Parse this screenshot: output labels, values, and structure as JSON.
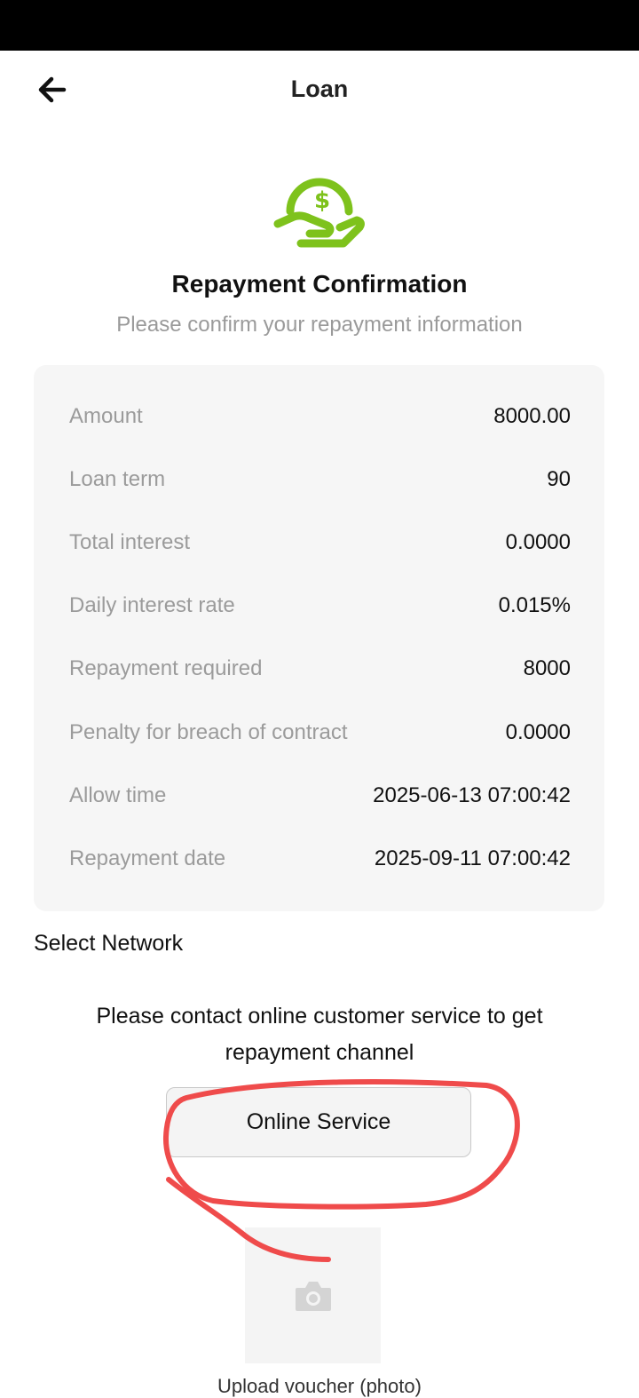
{
  "header": {
    "title": "Loan"
  },
  "hero": {
    "icon": "hand-dollar-icon",
    "title": "Repayment Confirmation",
    "subtitle": "Please confirm your repayment information"
  },
  "details": [
    {
      "label": "Amount",
      "value": "8000.00"
    },
    {
      "label": "Loan term",
      "value": "90"
    },
    {
      "label": "Total interest",
      "value": "0.0000"
    },
    {
      "label": "Daily interest rate",
      "value": "0.015%"
    },
    {
      "label": "Repayment required",
      "value": "8000"
    },
    {
      "label": "Penalty for breach of contract",
      "value": "0.0000"
    },
    {
      "label": "Allow time",
      "value": "2025-06-13 07:00:42"
    },
    {
      "label": "Repayment date",
      "value": "2025-09-11 07:00:42"
    }
  ],
  "network": {
    "label": "Select Network",
    "message": "Please contact online customer service to get repayment channel",
    "button_label": "Online Service"
  },
  "upload": {
    "icon": "camera-icon",
    "caption": "Upload voucher (photo)"
  },
  "colors": {
    "accent_green": "#7ec21c",
    "annotation_red": "#ef4b4b",
    "card_bg": "#f6f6f6"
  }
}
